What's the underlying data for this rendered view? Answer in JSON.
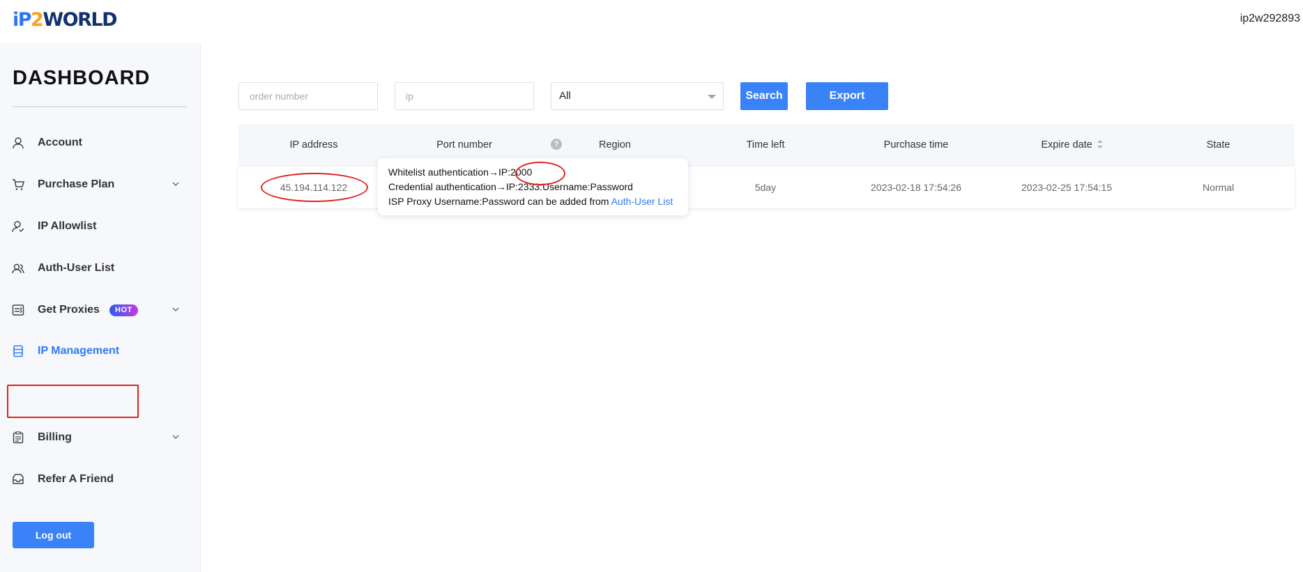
{
  "header": {
    "logo_parts": [
      "iP",
      "2",
      "WORLD"
    ],
    "username": "ip2w292893"
  },
  "sidebar": {
    "title": "DASHBOARD",
    "items": [
      {
        "label": "Account",
        "icon": "user-icon"
      },
      {
        "label": "Purchase Plan",
        "icon": "cart-icon",
        "expandable": true
      },
      {
        "label": "IP Allowlist",
        "icon": "user-check-icon"
      },
      {
        "label": "Auth-User List",
        "icon": "users-icon"
      },
      {
        "label": "Get Proxies",
        "icon": "proxies-icon",
        "expandable": true,
        "badge": "HOT"
      },
      {
        "label": "IP Management",
        "icon": "database-icon",
        "active": true
      },
      {
        "label": "Billing",
        "icon": "clipboard-icon",
        "expandable": true
      },
      {
        "label": "Refer A Friend",
        "icon": "inbox-icon"
      }
    ],
    "logout_label": "Log out"
  },
  "filters": {
    "order_placeholder": "order number",
    "ip_placeholder": "ip",
    "select_value": "All",
    "search_label": "Search",
    "export_label": "Export"
  },
  "table": {
    "columns": [
      "IP address",
      "Port number",
      "Region",
      "Time left",
      "Purchase time",
      "Expire date",
      "State"
    ],
    "rows": [
      {
        "ip": "45.194.114.122",
        "port": "",
        "region": "",
        "time_left": "5day",
        "purchase_time": "2023-02-18 17:54:26",
        "expire_date": "2023-02-25 17:54:15",
        "state": "Normal"
      }
    ]
  },
  "tooltip": {
    "line1_prefix": "Whitelist authentication→IP:",
    "line1_port": "2000",
    "line2": "Credential authentication→IP:2333:Username:Password",
    "line3_prefix": "ISP Proxy Username:Password can be added from ",
    "line3_link": "Auth-User List"
  },
  "colors": {
    "accent": "#3a82f7",
    "annotation_red": "#e02020",
    "sidebar_bg": "#f6f8fc"
  }
}
